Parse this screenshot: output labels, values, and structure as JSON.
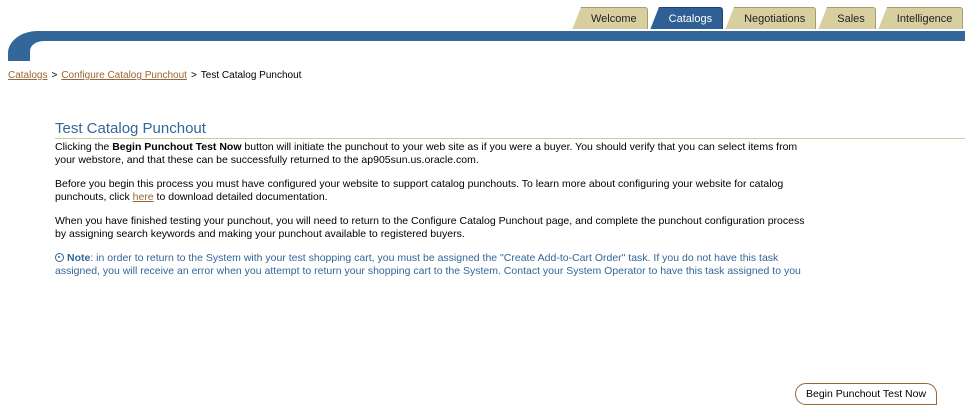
{
  "tabs": [
    {
      "label": "Welcome",
      "active": false
    },
    {
      "label": "Catalogs",
      "active": true
    },
    {
      "label": "Negotiations",
      "active": false
    },
    {
      "label": "Sales",
      "active": false
    },
    {
      "label": "Intelligence",
      "active": false
    }
  ],
  "breadcrumb": {
    "item1": "Catalogs",
    "item2": "Configure Catalog Punchout",
    "current": "Test Catalog Punchout",
    "separator": ">"
  },
  "page": {
    "title": "Test Catalog Punchout",
    "p1_pre": "Clicking the ",
    "p1_bold": "Begin Punchout Test Now",
    "p1_post": " button will initiate the punchout to your web site as if you were a buyer. You should verify that you can select items from",
    "p1_line2": "your webstore, and that these can be successfully returned to the ap905sun.us.oracle.com.",
    "p2_line1": "Before you begin this process you must have configured your website to support catalog punchouts. To learn more about configuring your website for catalog",
    "p2_pre": "punchouts, click ",
    "p2_link": "here",
    "p2_post": " to download detailed documentation.",
    "p3_line1": "When you have finished testing your punchout, you will need to return to the Configure Catalog Punchout page, and complete the punchout configuration process",
    "p3_line2": "by assigning search keywords and making your punchout available to registered buyers.",
    "note_label": "Note",
    "note_line1": ": in order to return to the System with your test shopping cart, you must be assigned the \"Create Add-to-Cart Order\" task. If you do not have this task",
    "note_line2": "assigned, you will receive an error when you attempt to return your shopping cart to the System. Contact your System Operator to have this task assigned to you"
  },
  "button": {
    "label": "Begin Punchout Test Now"
  },
  "colors": {
    "brand": "#336699",
    "link": "#996633",
    "tab": "#d8cfa0"
  }
}
